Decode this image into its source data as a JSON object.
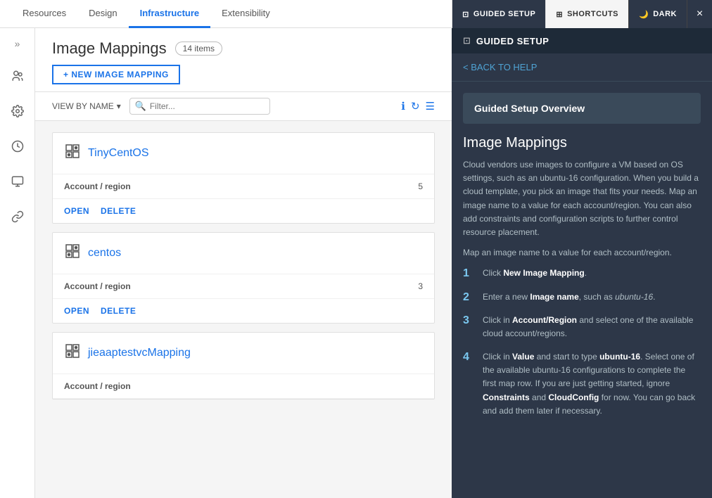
{
  "topNav": {
    "tabs": [
      {
        "id": "resources",
        "label": "Resources",
        "active": false
      },
      {
        "id": "design",
        "label": "Design",
        "active": false
      },
      {
        "id": "infrastructure",
        "label": "Infrastructure",
        "active": true
      },
      {
        "id": "extensibility",
        "label": "Extensibility",
        "active": false
      }
    ],
    "guidedSetupLabel": "GUIDED SETUP",
    "shortcutsLabel": "SHORTCUTS",
    "darkLabel": "DARK",
    "closeLabel": "×"
  },
  "sidebar": {
    "expandIcon": "»",
    "icons": [
      "👥",
      "⚙",
      "🕐",
      "📊",
      "🔗"
    ]
  },
  "panel": {
    "title": "Image Mappings",
    "itemsBadge": "14 items",
    "newButtonLabel": "+ NEW IMAGE MAPPING",
    "viewByLabel": "VIEW BY NAME",
    "filterPlaceholder": "Filter...",
    "cards": [
      {
        "id": "tiny-centos",
        "icon": "⊞",
        "title": "TinyCentOS",
        "accountRegionLabel": "Account / region",
        "accountRegionValue": "5",
        "openLabel": "OPEN",
        "deleteLabel": "DELETE"
      },
      {
        "id": "centos",
        "icon": "⊞",
        "title": "centos",
        "accountRegionLabel": "Account / region",
        "accountRegionValue": "3",
        "openLabel": "OPEN",
        "deleteLabel": "DELETE"
      },
      {
        "id": "jieaaptestvcmapping",
        "icon": "⊞",
        "title": "jieaaptestvcMapping",
        "accountRegionLabel": "Account / region",
        "accountRegionValue": "",
        "openLabel": "OPEN",
        "deleteLabel": "DELETE"
      }
    ]
  },
  "guidedPanel": {
    "headerTitle": "GUIDED SETUP",
    "backLabel": "< BACK TO HELP",
    "overviewBoxLabel": "Guided Setup Overview",
    "sectionTitle": "Image Mappings",
    "description1": "Cloud vendors use images to configure a VM based on OS settings, such as an ubuntu-16 configuration. When you build a cloud template, you pick an image that fits your needs. Map an image name to a value for each account/region. You can also add constraints and configuration scripts to further control resource placement.",
    "description2": "Map an image name to a value for each account/region.",
    "steps": [
      {
        "num": "1",
        "text": "Click <b>New Image Mapping</b>."
      },
      {
        "num": "2",
        "text": "Enter a new <b>Image name</b>, such as <em>ubuntu-16</em>."
      },
      {
        "num": "3",
        "text": "Click in <b>Account/Region</b> and select one of the available cloud account/regions."
      },
      {
        "num": "4",
        "text": "Click in <b>Value</b> and start to type <b>ubuntu-16</b>. Select one of the available ubuntu-16 configurations to complete the first map row. If you are just getting started, ignore <b>Constraints</b> and <b>CloudConfig</b> for now. You can go back and add them later if necessary."
      }
    ]
  }
}
